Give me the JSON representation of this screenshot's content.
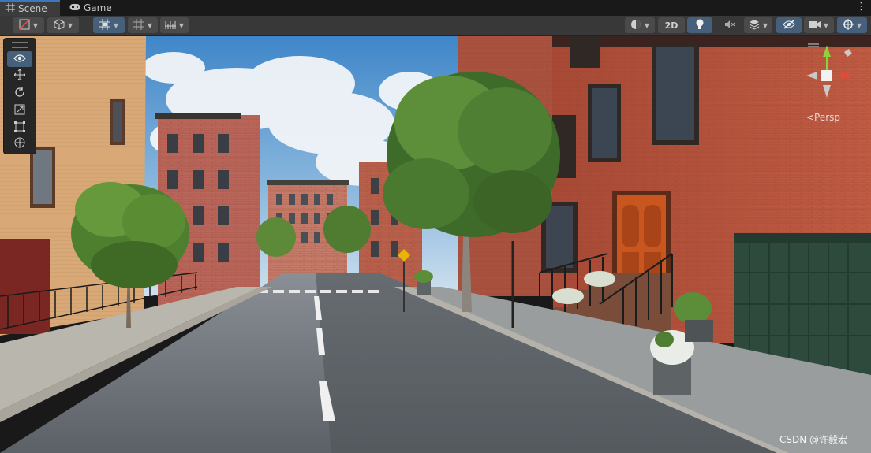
{
  "tabs": [
    {
      "label": "Scene",
      "icon": "grid-icon",
      "active": true
    },
    {
      "label": "Game",
      "icon": "gamepad-icon",
      "active": false
    }
  ],
  "toolbar": {
    "two_d_label": "2D"
  },
  "orientation_gizmo": {
    "projection_label": "<Persp"
  },
  "watermark": "CSDN @许毅宏",
  "colors": {
    "window_bg": "#191919",
    "toolbar_bg": "#383838",
    "button_active": "#46607c",
    "tab_accent": "#3a79bb",
    "gizmo_x": "#e8473b",
    "gizmo_y": "#8ad33a",
    "gizmo_z": "#4a8ae8"
  },
  "tools": [
    {
      "name": "view-tool",
      "icon": "eye-icon",
      "active": true
    },
    {
      "name": "move-tool",
      "icon": "move-arrows-icon",
      "active": false
    },
    {
      "name": "rotate-tool",
      "icon": "rotate-icon",
      "active": false
    },
    {
      "name": "scale-tool",
      "icon": "scale-icon",
      "active": false
    },
    {
      "name": "rect-tool",
      "icon": "rect-icon",
      "active": false
    },
    {
      "name": "transform-tool",
      "icon": "transform-icon",
      "active": false
    }
  ]
}
